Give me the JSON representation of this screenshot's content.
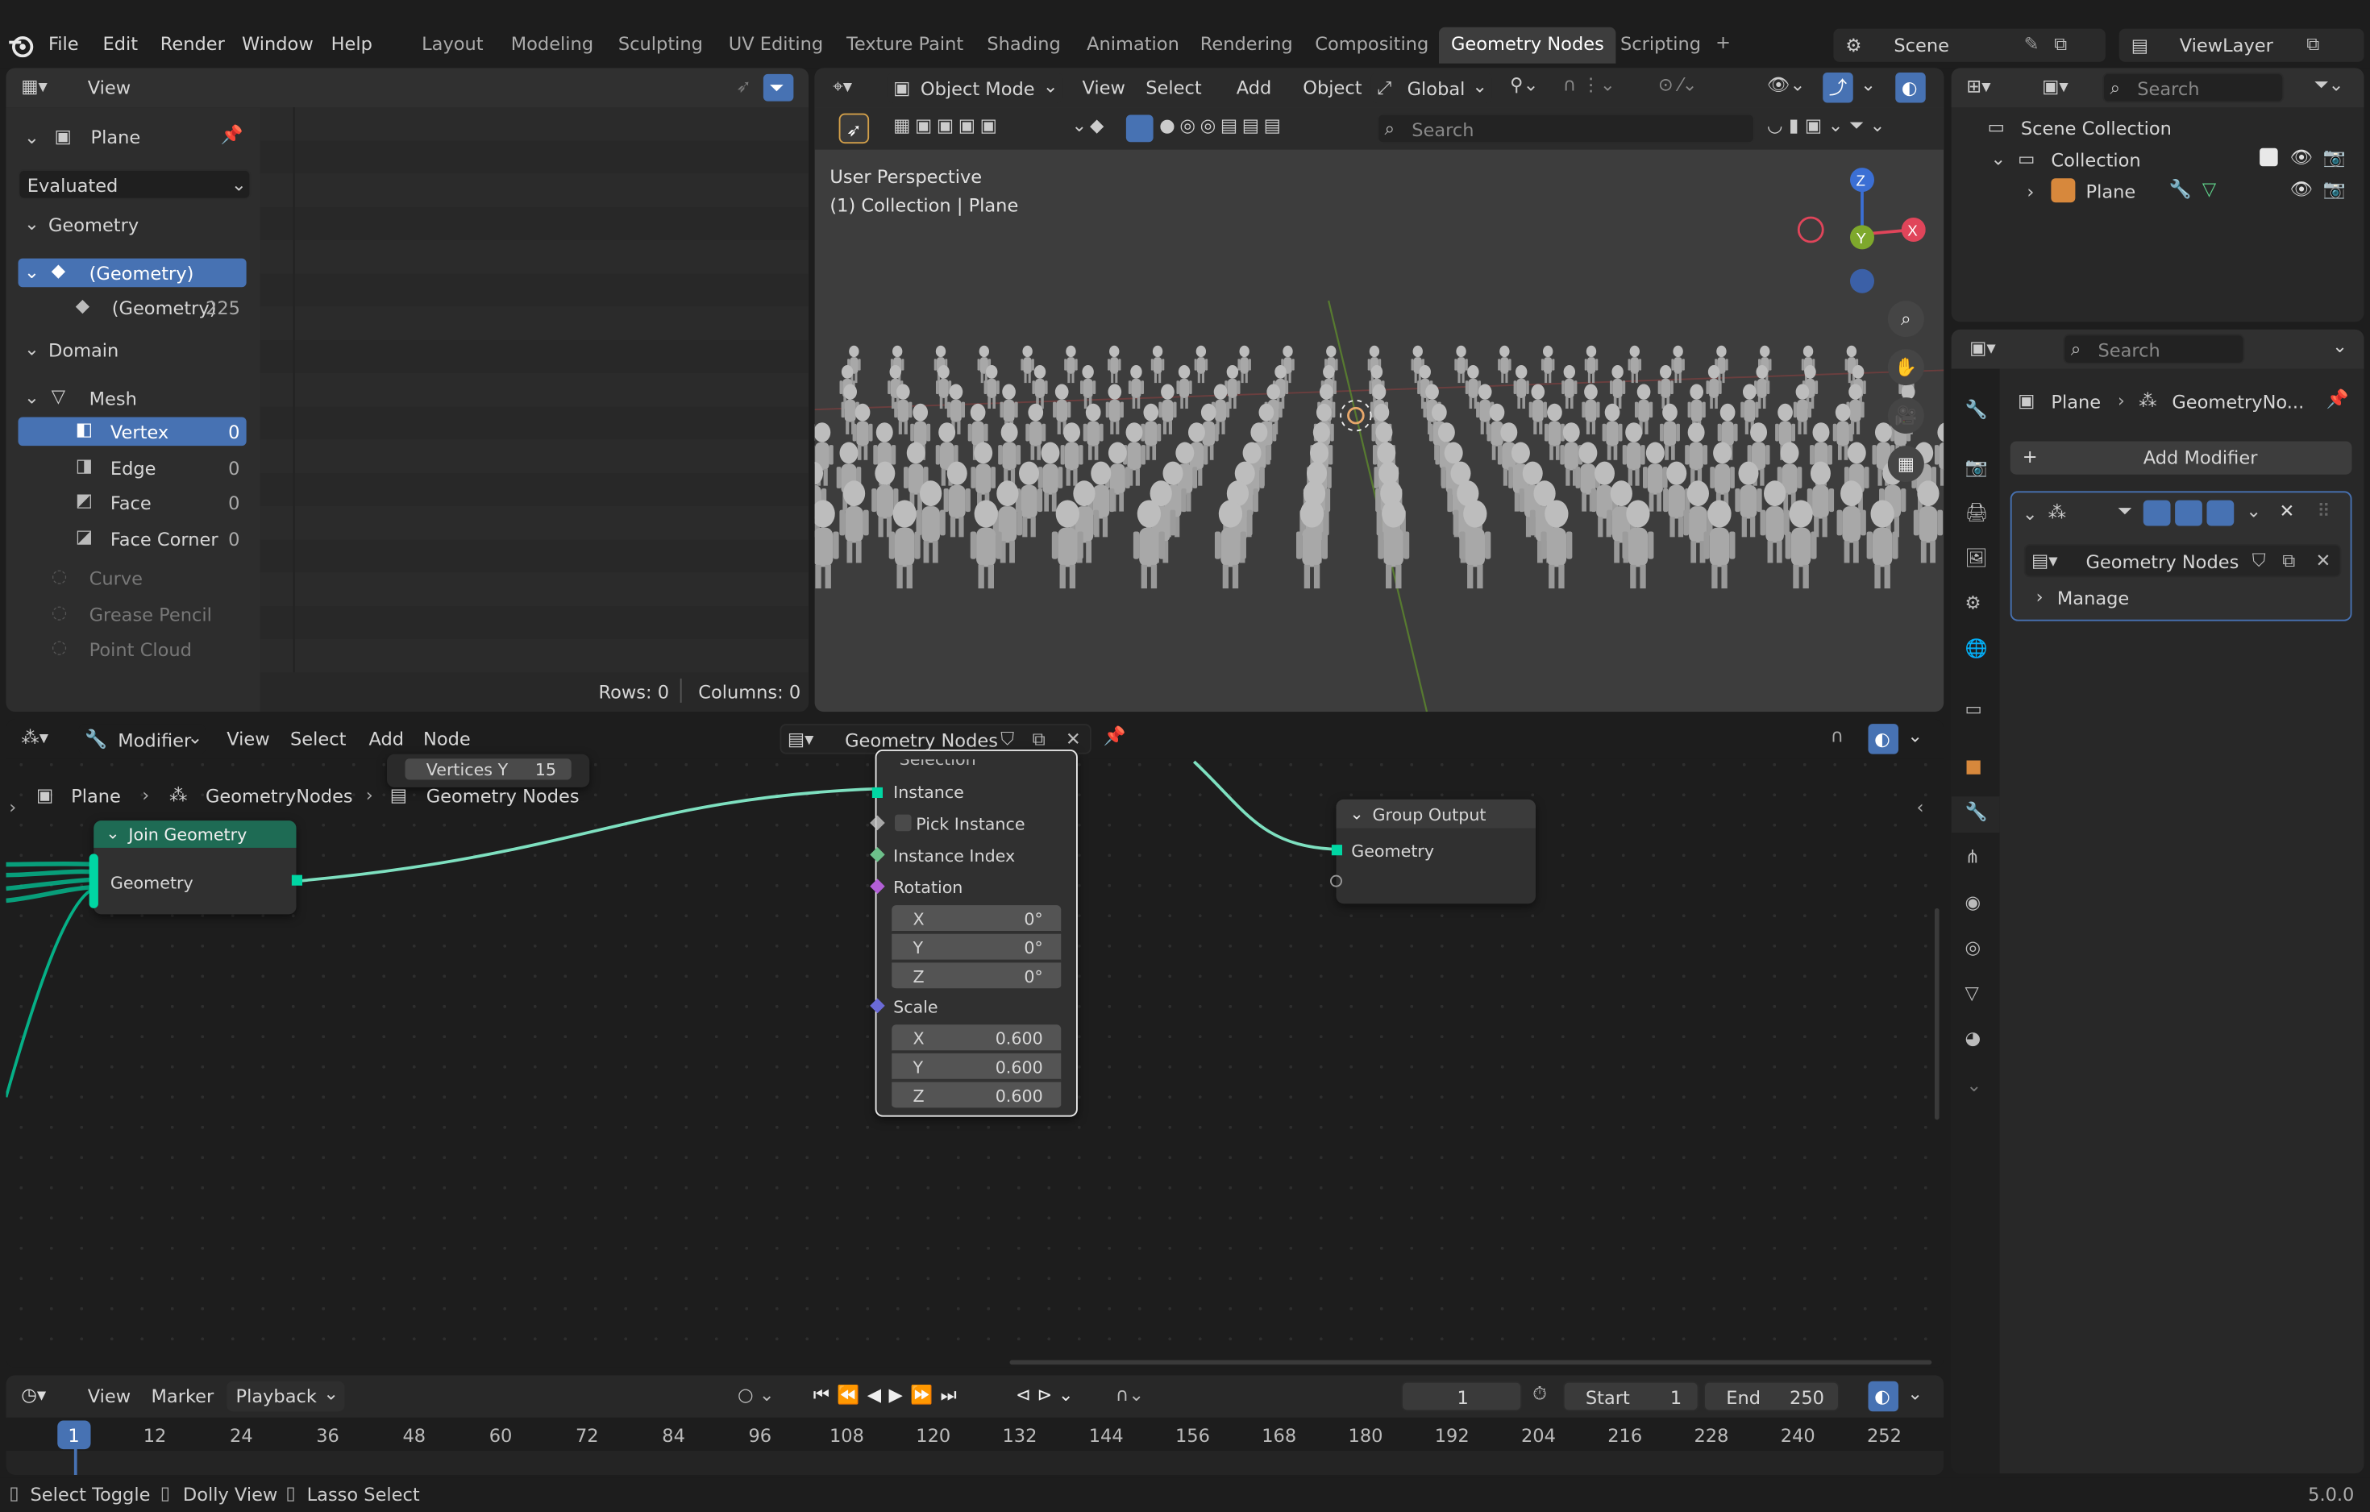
{
  "topbar": {
    "menus": [
      "File",
      "Edit",
      "Render",
      "Window",
      "Help"
    ],
    "workspaces": [
      "Layout",
      "Modeling",
      "Sculpting",
      "UV Editing",
      "Texture Paint",
      "Shading",
      "Animation",
      "Rendering",
      "Compositing",
      "Geometry Nodes",
      "Scripting"
    ],
    "active_workspace": "Geometry Nodes",
    "add": "+",
    "scene": "Scene",
    "view_layer": "ViewLayer"
  },
  "spreadsheet": {
    "header_view": "View",
    "object": "Plane",
    "evaluated": "Evaluated",
    "geometry_label": "Geometry",
    "geometry_item": "(Geometry)",
    "geometry_sub": "(Geometry)",
    "geometry_sub_count": "225",
    "domain_label": "Domain",
    "mesh": "Mesh",
    "domains": [
      {
        "name": "Vertex",
        "count": "0"
      },
      {
        "name": "Edge",
        "count": "0"
      },
      {
        "name": "Face",
        "count": "0"
      },
      {
        "name": "Face Corner",
        "count": "0"
      }
    ],
    "disabled": [
      "Curve",
      "Grease Pencil",
      "Point Cloud"
    ],
    "rows": "Rows: 0",
    "cols": "Columns: 0"
  },
  "viewport": {
    "mode": "Object Mode",
    "menus": [
      "View",
      "Select",
      "Add",
      "Object"
    ],
    "orientation": "Global",
    "search_placeholder": "Search",
    "overlay1": "User Perspective",
    "overlay2": "(1) Collection | Plane",
    "axis": {
      "z": "Z",
      "y": "Y",
      "x": "X"
    },
    "colors": {
      "x": "#e0455a",
      "y": "#7ea82c",
      "z": "#3b6fd4"
    }
  },
  "outliner": {
    "search_placeholder": "Search",
    "scene_collection": "Scene Collection",
    "collection": "Collection",
    "plane": "Plane"
  },
  "properties": {
    "search_placeholder": "Search",
    "breadcrumb_obj": "Plane",
    "breadcrumb_mod": "GeometryNo...",
    "add_modifier": "Add Modifier",
    "node_group": "Geometry Nodes",
    "manage": "Manage"
  },
  "node_editor": {
    "editor_type": "Modifier",
    "menus": [
      "View",
      "Select",
      "Add",
      "Node"
    ],
    "tree_name": "Geometry Nodes",
    "breadcrumb": [
      "Plane",
      "GeometryNodes",
      "Geometry Nodes"
    ],
    "vertices_y_label": "Vertices Y",
    "vertices_y_value": "15",
    "join": {
      "title": "Join Geometry",
      "socket": "Geometry"
    },
    "instance_node": {
      "selection": "Selection",
      "instance": "Instance",
      "pick_instance": "Pick Instance",
      "instance_index": "Instance Index",
      "rotation": "Rotation",
      "rot": [
        {
          "axis": "X",
          "value": "0°"
        },
        {
          "axis": "Y",
          "value": "0°"
        },
        {
          "axis": "Z",
          "value": "0°"
        }
      ],
      "scale": "Scale",
      "sca": [
        {
          "axis": "X",
          "value": "0.600"
        },
        {
          "axis": "Y",
          "value": "0.600"
        },
        {
          "axis": "Z",
          "value": "0.600"
        }
      ]
    },
    "output": {
      "title": "Group Output",
      "socket": "Geometry"
    }
  },
  "timeline": {
    "menus": [
      "View",
      "Marker",
      "Playback"
    ],
    "current_frame": "1",
    "start_label": "Start",
    "start": "1",
    "end_label": "End",
    "end": "250",
    "ticks": [
      "12",
      "24",
      "36",
      "48",
      "60",
      "72",
      "84",
      "96",
      "108",
      "120",
      "132",
      "144",
      "156",
      "168",
      "180",
      "192",
      "204",
      "216",
      "228",
      "240",
      "252"
    ],
    "playhead": "1"
  },
  "statusbar": {
    "items": [
      "Select Toggle",
      "Dolly View",
      "Lasso Select"
    ],
    "version": "5.0.0"
  }
}
